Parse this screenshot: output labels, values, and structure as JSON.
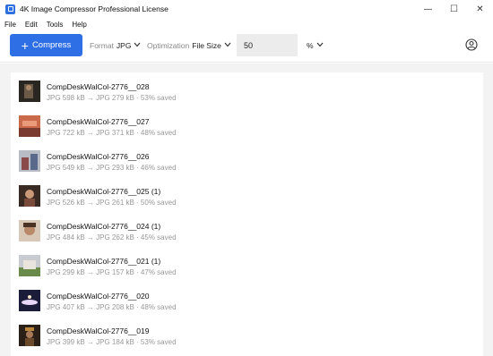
{
  "window": {
    "title": "4K Image Compressor Professional License",
    "minimize": "—",
    "maximize": "☐",
    "close": "✕"
  },
  "menu": [
    "File",
    "Edit",
    "Tools",
    "Help"
  ],
  "toolbar": {
    "compress_label": "Compress",
    "format_label": "Format",
    "format_value": "JPG",
    "optimization_label": "Optimization",
    "optimization_value": "File Size",
    "quality_value": "50",
    "unit_value": "%"
  },
  "files": [
    {
      "name": "CompDeskWalCol-2776__028",
      "stats": "JPG 598 kB → JPG 279 kB · 53% saved"
    },
    {
      "name": "CompDeskWalCol-2776__027",
      "stats": "JPG 722 kB → JPG 371 kB · 48% saved"
    },
    {
      "name": "CompDeskWalCol-2776__026",
      "stats": "JPG 549 kB → JPG 293 kB · 46% saved"
    },
    {
      "name": "CompDeskWalCol-2776__025 (1)",
      "stats": "JPG 526 kB → JPG 261 kB · 50% saved"
    },
    {
      "name": "CompDeskWalCol-2776__024 (1)",
      "stats": "JPG 484 kB → JPG 262 kB · 45% saved"
    },
    {
      "name": "CompDeskWalCol-2776__021 (1)",
      "stats": "JPG 299 kB → JPG 157 kB · 47% saved"
    },
    {
      "name": "CompDeskWalCol-2776__020",
      "stats": "JPG 407 kB → JPG 208 kB · 48% saved"
    },
    {
      "name": "CompDeskWalCol-2776__019",
      "stats": "JPG 399 kB → JPG 184 kB · 53% saved"
    }
  ],
  "colors": {
    "accent": "#2f6fe6",
    "content_bg": "#f3f3f3"
  }
}
